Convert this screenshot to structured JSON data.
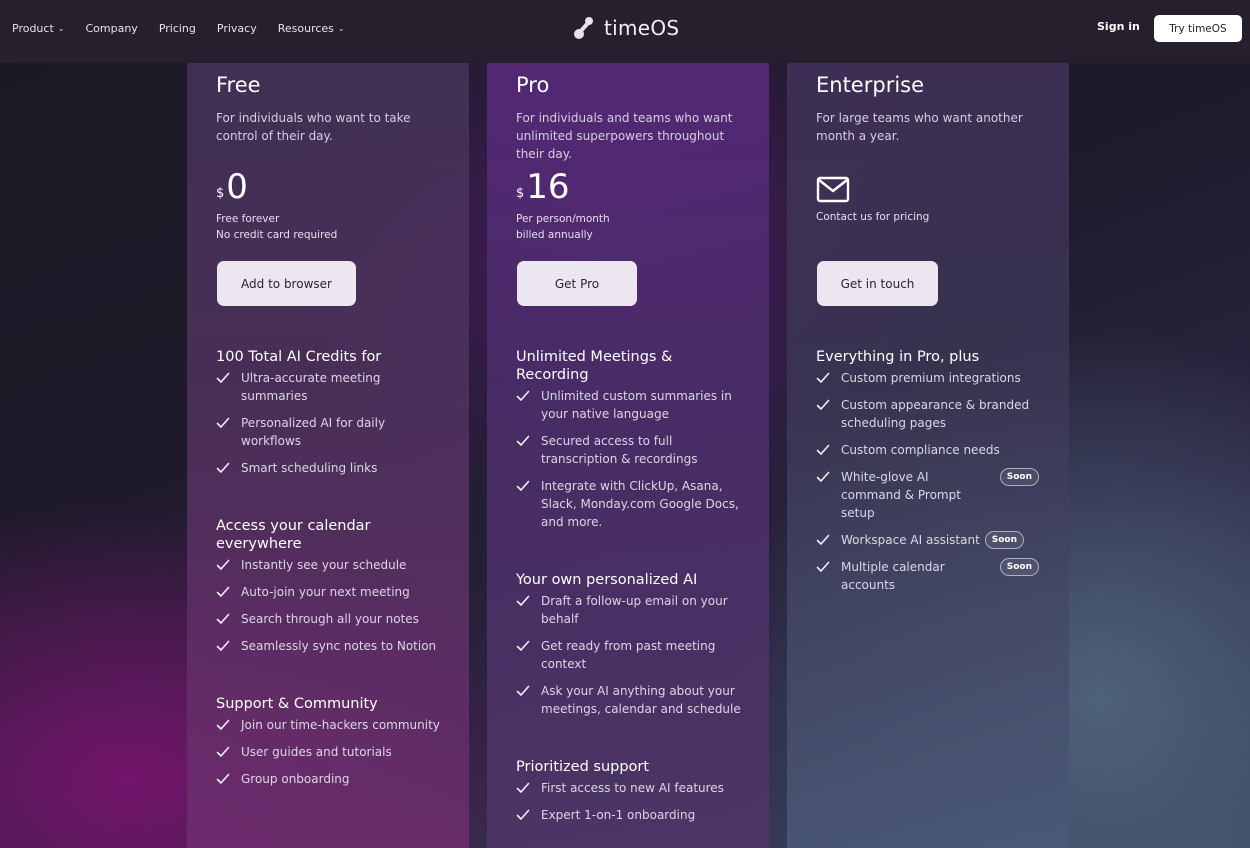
{
  "nav": {
    "items": [
      {
        "label": "Product",
        "dropdown": true
      },
      {
        "label": "Company",
        "dropdown": false
      },
      {
        "label": "Pricing",
        "dropdown": false
      },
      {
        "label": "Privacy",
        "dropdown": false
      },
      {
        "label": "Resources",
        "dropdown": true
      }
    ],
    "logo_text": "timeOS",
    "signin": "Sign in",
    "try_button": "Try timeOS"
  },
  "plans": {
    "free": {
      "name": "Free",
      "desc": "For individuals who want to take control of their day.",
      "currency": "$",
      "price": "0",
      "note1": "Free forever",
      "note2": "No credit card required",
      "cta": "Add to browser",
      "sections": [
        {
          "title": "100 Total AI Credits for",
          "items": [
            "Ultra-accurate meeting summaries",
            "Personalized AI for daily workflows",
            "Smart scheduling links"
          ]
        },
        {
          "title": "Access your calendar everywhere",
          "items": [
            "Instantly see your schedule",
            "Auto-join your next meeting",
            "Search through all your notes",
            "Seamlessly sync notes to Notion"
          ]
        },
        {
          "title": "Support & Community",
          "items": [
            "Join our time-hackers community",
            "User guides and tutorials",
            "Group onboarding"
          ]
        }
      ]
    },
    "pro": {
      "name": "Pro",
      "desc": "For individuals and teams who want unlimited superpowers throughout their day.",
      "currency": "$",
      "price": "16",
      "note1": "Per person/month",
      "note2": "billed annually",
      "cta": "Get Pro",
      "sections": [
        {
          "title": "Unlimited Meetings & Recording",
          "items": [
            "Unlimited custom summaries in your native language",
            "Secured access to full transcription & recordings",
            "Integrate with ClickUp, Asana, Slack, Monday.com Google Docs, and more."
          ]
        },
        {
          "title": "Your own personalized AI",
          "items": [
            "Draft a follow-up email on your behalf",
            "Get ready from past meeting context",
            "Ask your AI anything about your meetings, calendar and schedule"
          ]
        },
        {
          "title": "Prioritized support",
          "items": [
            "First access to new AI features",
            "Expert 1-on-1 onboarding"
          ]
        }
      ]
    },
    "enterprise": {
      "name": "Enterprise",
      "desc": "For large teams who want another month a year.",
      "icon": "mail-icon",
      "note1": "Contact us for pricing",
      "cta": "Get in touch",
      "soon_label": "Soon",
      "sections": [
        {
          "title": "Everything in Pro, plus",
          "items": [
            "Custom premium integrations",
            "Custom appearance & branded scheduling pages",
            "Custom compliance needs",
            "White-glove AI command & Prompt setup",
            "Workspace AI assistant",
            "Multiple calendar accounts"
          ],
          "soon": [
            false,
            false,
            false,
            true,
            true,
            true
          ]
        }
      ]
    }
  }
}
